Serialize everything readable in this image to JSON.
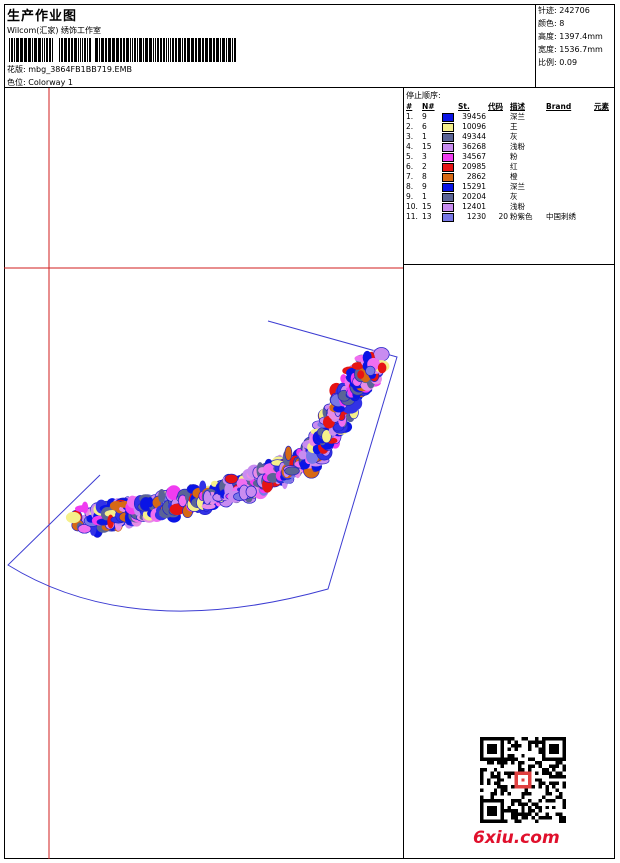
{
  "header": {
    "title": "生产作业图",
    "company": "Wilcom(汇家) 绣饰工作室",
    "design_label": "花版:",
    "design_name": "mbg_3864FB1BB719.EMB",
    "colorway_label": "色位:",
    "colorway_name": "Colorway 1"
  },
  "stats": {
    "stitches_label": "针迹:",
    "stitches": "242706",
    "colors_label": "颜色:",
    "colors": "8",
    "height_label": "高度:",
    "height": "1397.4mm",
    "width_label": "宽度:",
    "width": "1536.7mm",
    "scale_label": "比例:",
    "scale": "0.09"
  },
  "sequence": {
    "title": "停止顺序:",
    "headers": [
      "#",
      "N#",
      "St.",
      "代码",
      "描述",
      "Brand",
      "元素"
    ],
    "rows": [
      {
        "idx": "1.",
        "n": "9",
        "color": "#0a14e6",
        "st": "39456",
        "code": "",
        "desc": "深兰",
        "brand": ""
      },
      {
        "idx": "2.",
        "n": "6",
        "color": "#f5f08a",
        "st": "10096",
        "code": "",
        "desc": "王",
        "brand": ""
      },
      {
        "idx": "3.",
        "n": "1",
        "color": "#5a6496",
        "st": "49344",
        "code": "",
        "desc": "灰",
        "brand": ""
      },
      {
        "idx": "4.",
        "n": "15",
        "color": "#c88cf0",
        "st": "36268",
        "code": "",
        "desc": "浅粉",
        "brand": ""
      },
      {
        "idx": "5.",
        "n": "3",
        "color": "#f03cf0",
        "st": "34567",
        "code": "",
        "desc": "粉",
        "brand": ""
      },
      {
        "idx": "6.",
        "n": "2",
        "color": "#e61414",
        "st": "20985",
        "code": "",
        "desc": "红",
        "brand": ""
      },
      {
        "idx": "7.",
        "n": "8",
        "color": "#d76914",
        "st": "2862",
        "code": "",
        "desc": "橙",
        "brand": ""
      },
      {
        "idx": "8.",
        "n": "9",
        "color": "#0a14e6",
        "st": "15291",
        "code": "",
        "desc": "深兰",
        "brand": ""
      },
      {
        "idx": "9.",
        "n": "1",
        "color": "#5a6496",
        "st": "20204",
        "code": "",
        "desc": "灰",
        "brand": ""
      },
      {
        "idx": "10.",
        "n": "15",
        "color": "#c88cf0",
        "st": "12401",
        "code": "",
        "desc": "浅粉",
        "brand": ""
      },
      {
        "idx": "11.",
        "n": "13",
        "color": "#7878e6",
        "st": "1230",
        "code": "20",
        "desc": "粉紫色",
        "brand": "中国刺绣"
      }
    ]
  },
  "watermark": {
    "site": "6xiu.com"
  }
}
